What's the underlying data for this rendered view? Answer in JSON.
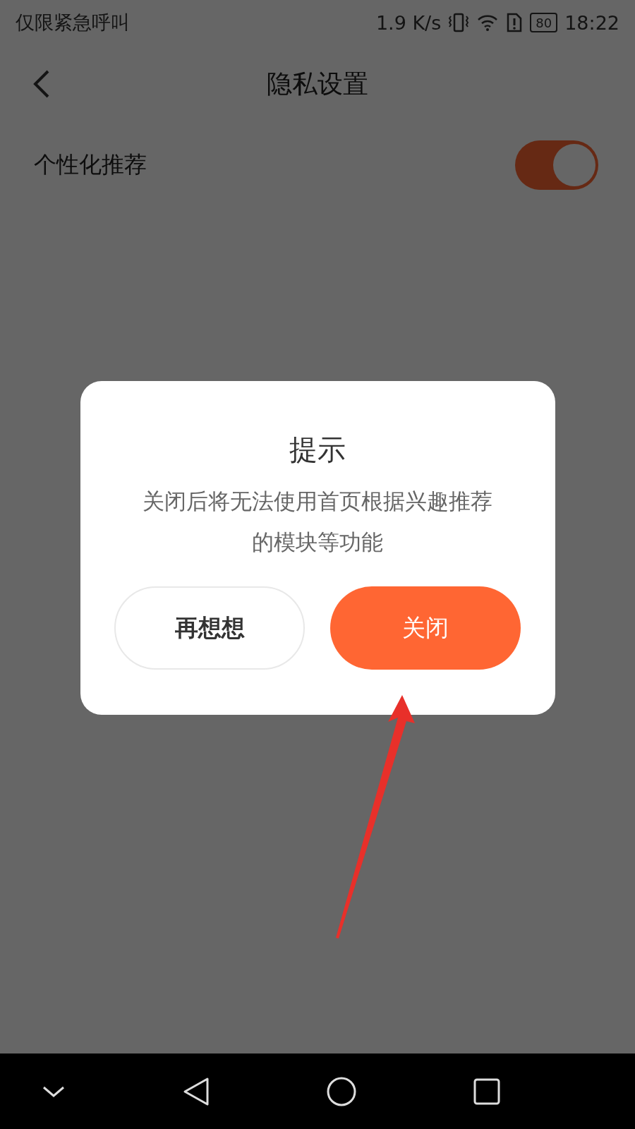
{
  "status_bar": {
    "carrier": "仅限紧急呼叫",
    "speed": "1.9 K/s",
    "battery": "80",
    "time": "18:22"
  },
  "header": {
    "title": "隐私设置"
  },
  "settings": [
    {
      "label": "个性化推荐",
      "on": true
    }
  ],
  "dialog": {
    "title": "提示",
    "message": "关闭后将无法使用首页根据兴趣推荐的模块等功能",
    "buttons": [
      {
        "label": "再想想",
        "kind": "secondary"
      },
      {
        "label": "关闭",
        "kind": "primary"
      }
    ]
  }
}
